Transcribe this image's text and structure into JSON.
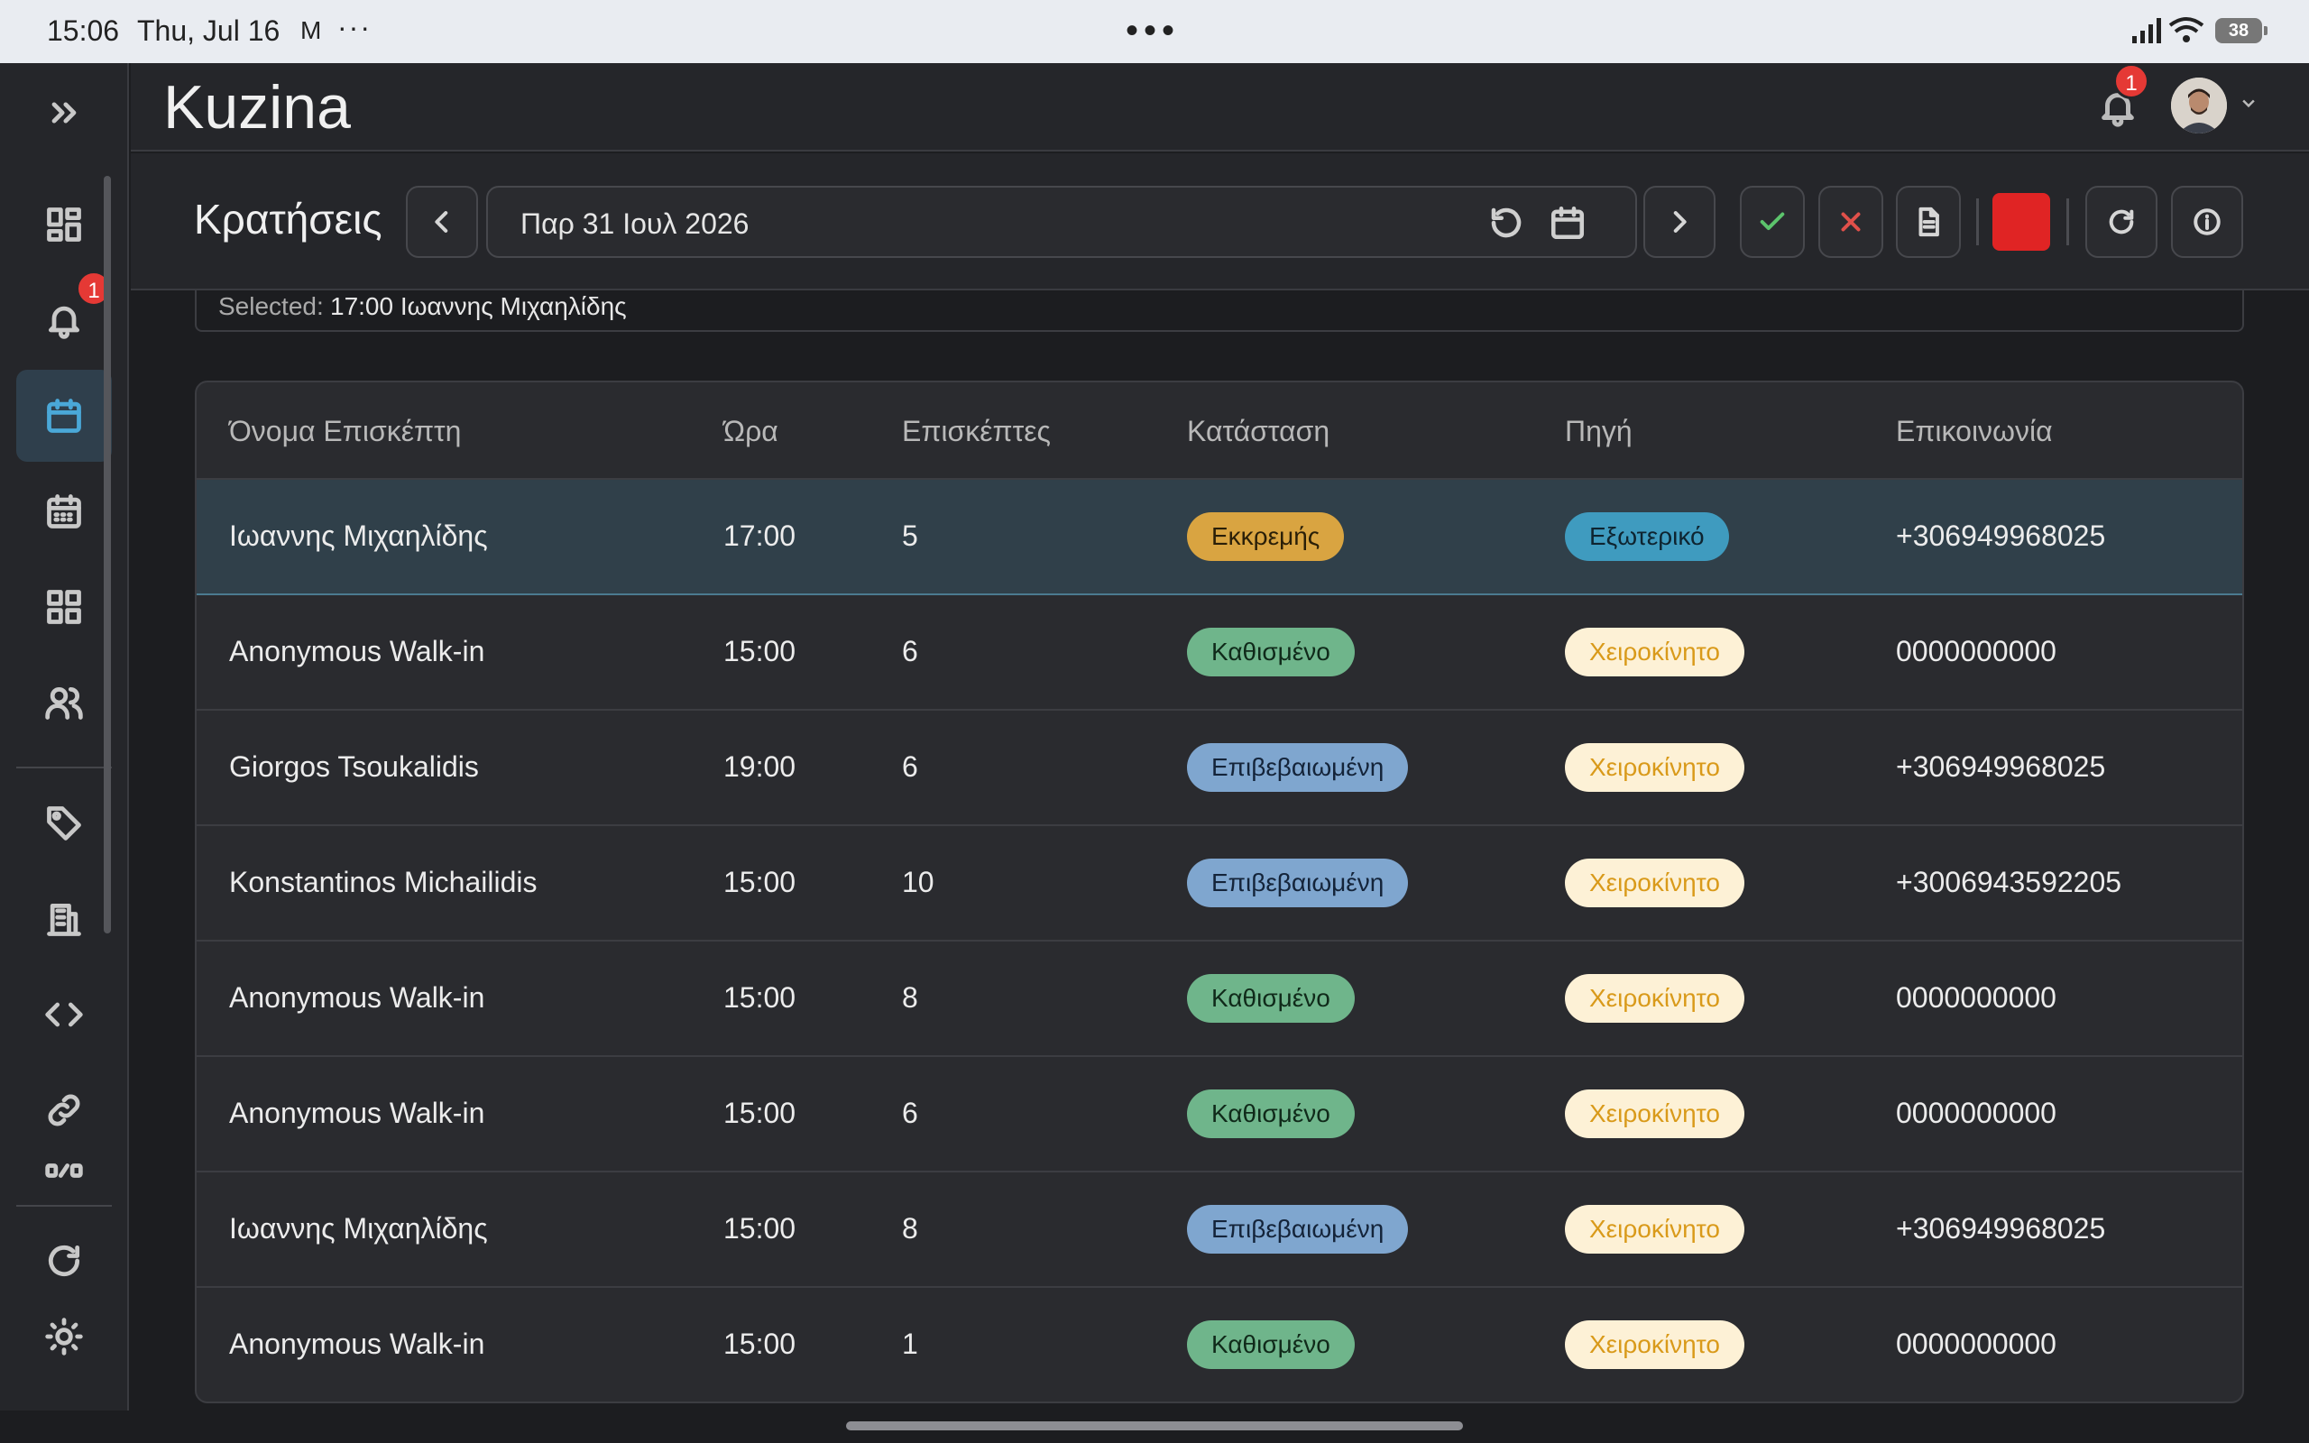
{
  "status_bar": {
    "time": "15:06",
    "date": "Thu, Jul 16",
    "mail_icon": "M",
    "more": "···",
    "center_dots": "•••",
    "battery": "38"
  },
  "header": {
    "app_title": "Kuzina",
    "notification_count": "1"
  },
  "sidebar": {
    "notification_count": "1",
    "items": [
      "expand-icon",
      "dashboard-icon",
      "bell-icon",
      "calendar-icon",
      "calendar-grid-icon",
      "grid-icon",
      "users-icon",
      "tag-icon",
      "building-icon",
      "code-icon",
      "link-icon",
      "switch-icon",
      "refresh-icon",
      "sun-icon"
    ]
  },
  "toolbar": {
    "page_title": "Κρατήσεις",
    "date_value": "Παρ 31 Ιουλ 2026",
    "status_color": "#e02424"
  },
  "selected": {
    "label": "Selected:",
    "value": "17:00 Ιωαννης Μιχαηλίδης"
  },
  "table": {
    "headers": [
      "Όνομα Επισκέπτη",
      "Ώρα",
      "Επισκέπτες",
      "Κατάσταση",
      "Πηγή",
      "Επικοινωνία"
    ],
    "rows": [
      {
        "name": "Ιωαννης Μιχαηλίδης",
        "time": "17:00",
        "guests": "5",
        "status": "Εκκρεμής",
        "status_kind": "pending",
        "source": "Εξωτερικό",
        "source_kind": "external",
        "contact": "+306949968025"
      },
      {
        "name": "Anonymous Walk-in",
        "time": "15:00",
        "guests": "6",
        "status": "Καθισμένο",
        "status_kind": "seated",
        "source": "Χειροκίνητο",
        "source_kind": "manual",
        "contact": "0000000000"
      },
      {
        "name": "Giorgos Tsoukalidis",
        "time": "19:00",
        "guests": "6",
        "status": "Επιβεβαιωμένη",
        "status_kind": "confirmed",
        "source": "Χειροκίνητο",
        "source_kind": "manual",
        "contact": "+306949968025"
      },
      {
        "name": "Konstantinos Michailidis",
        "time": "15:00",
        "guests": "10",
        "status": "Επιβεβαιωμένη",
        "status_kind": "confirmed",
        "source": "Χειροκίνητο",
        "source_kind": "manual",
        "contact": "+3006943592205"
      },
      {
        "name": "Anonymous Walk-in",
        "time": "15:00",
        "guests": "8",
        "status": "Καθισμένο",
        "status_kind": "seated",
        "source": "Χειροκίνητο",
        "source_kind": "manual",
        "contact": "0000000000"
      },
      {
        "name": "Anonymous Walk-in",
        "time": "15:00",
        "guests": "6",
        "status": "Καθισμένο",
        "status_kind": "seated",
        "source": "Χειροκίνητο",
        "source_kind": "manual",
        "contact": "0000000000"
      },
      {
        "name": "Ιωαννης Μιχαηλίδης",
        "time": "15:00",
        "guests": "8",
        "status": "Επιβεβαιωμένη",
        "status_kind": "confirmed",
        "source": "Χειροκίνητο",
        "source_kind": "manual",
        "contact": "+306949968025"
      },
      {
        "name": "Anonymous Walk-in",
        "time": "15:00",
        "guests": "1",
        "status": "Καθισμένο",
        "status_kind": "seated",
        "source": "Χειροκίνητο",
        "source_kind": "manual",
        "contact": "0000000000"
      }
    ]
  },
  "colors": {
    "pending": {
      "bg": "#d9a441",
      "fg": "#2a1f08"
    },
    "seated": {
      "bg": "#6fb58b",
      "fg": "#102a1a"
    },
    "confirmed": {
      "bg": "#7fa6cf",
      "fg": "#14243a"
    },
    "external": {
      "bg": "#3f9bbf",
      "fg": "#0e2430"
    },
    "manual": {
      "bg": "#fdf1d6",
      "fg": "#d99a1a"
    },
    "accent": "#4aa8d8"
  }
}
